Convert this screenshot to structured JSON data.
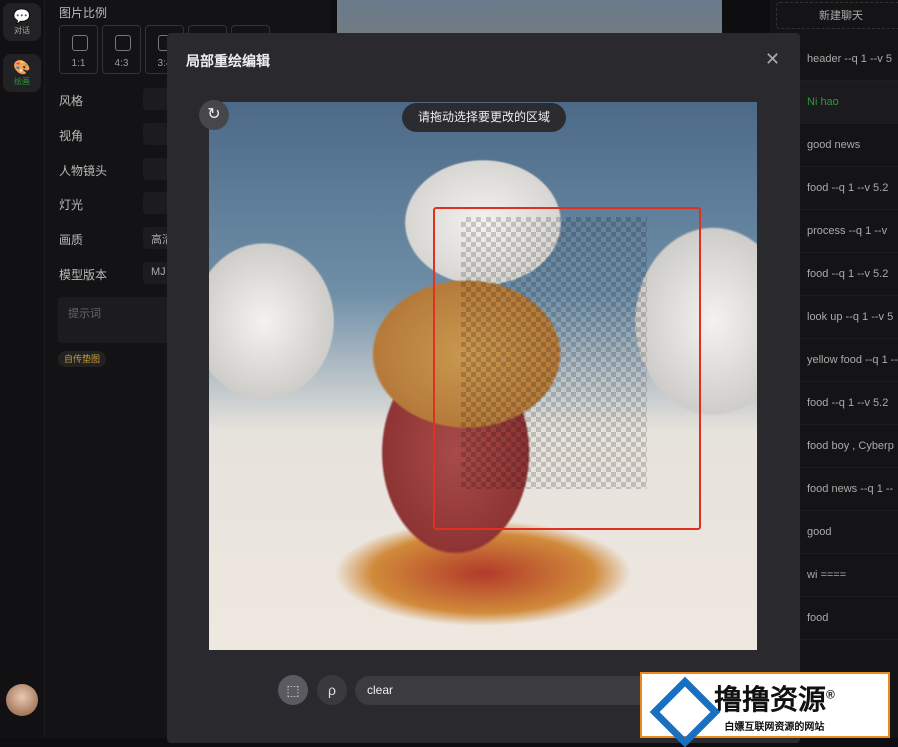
{
  "rail": {
    "chat_label": "对话",
    "draw_label": "绘画"
  },
  "settings": {
    "ratio_label": "图片比例",
    "ratios": [
      "1:1",
      "4:3",
      "3:4",
      "",
      ""
    ],
    "style_label": "风格",
    "angle_label": "视角",
    "shot_label": "人物镜头",
    "light_label": "灯光",
    "quality_label": "画质",
    "quality_value": "高清",
    "model_label": "模型版本",
    "model_value": "MJ",
    "prompt_placeholder": "提示词",
    "upload_label": "自传垫图"
  },
  "history": {
    "new_chat": "新建聊天",
    "items": [
      "header --q 1 --v 5",
      "Ni hao",
      "good news",
      "food --q 1 --v 5.2",
      "process --q 1 --v",
      "food --q 1 --v 5.2",
      "look up --q 1 --v 5",
      "yellow food --q 1 --",
      "food --q 1 --v 5.2",
      "food boy , Cyberp",
      "food news --q 1 --",
      "good",
      "wi ====",
      "food"
    ],
    "active_index": 1
  },
  "modal": {
    "title": "局部重绘编辑",
    "hint": "请拖动选择要更改的区域",
    "input_value": "clear",
    "accent": "#e03020"
  },
  "watermark": {
    "title": "撸撸资源",
    "subtitle": "白嫖互联网资源的网站",
    "mark": "®"
  }
}
